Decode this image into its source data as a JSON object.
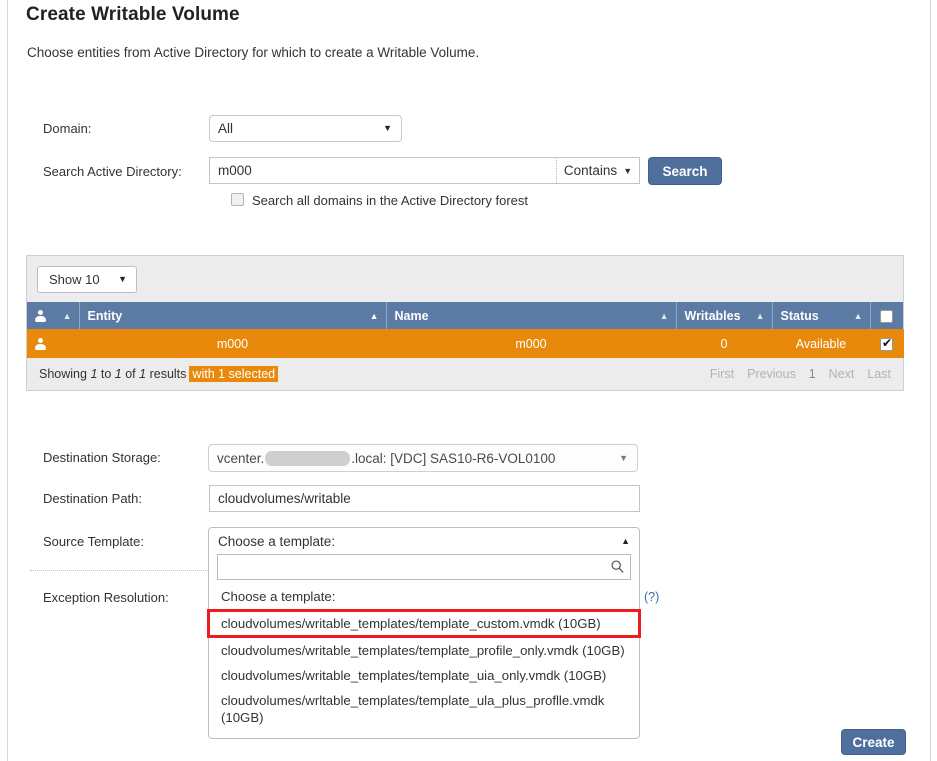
{
  "page": {
    "title": "Create Writable Volume",
    "subtitle": "Choose entities from Active Directory for which to create a Writable Volume."
  },
  "form": {
    "domain_label": "Domain:",
    "domain_value": "All",
    "search_label": "Search Active Directory:",
    "search_value": "m000",
    "search_placeholder": "",
    "search_scope_value": "Contains",
    "search_button_label": "Search",
    "search_all_domains_label": "Search all domains in the Active Directory forest",
    "search_all_domains_checked": false
  },
  "table": {
    "show_count_label": "Show 10",
    "columns": [
      {
        "label": "",
        "icon": "person-icon",
        "sort": "asc"
      },
      {
        "label": "Entity",
        "sort": "asc-active"
      },
      {
        "label": "Name",
        "sort": "asc"
      },
      {
        "label": "Writables",
        "sort": "asc"
      },
      {
        "label": "Status",
        "sort": "asc"
      },
      {
        "label": "",
        "icon": "select-all-checkbox",
        "sort": "none"
      }
    ],
    "rows": [
      {
        "entity": "m000",
        "name": "m000",
        "writables": "0",
        "status": "Available",
        "selected": true
      }
    ],
    "footer": {
      "showing_prefix": "Showing",
      "showing_from": "1",
      "showing_to_word": "to",
      "showing_to": "1",
      "showing_of_word": "of",
      "showing_total": "1",
      "showing_suffix": "results",
      "selected_badge": "with 1 selected",
      "pagination": [
        "First",
        "Previous",
        "1",
        "Next",
        "Last"
      ]
    }
  },
  "destination": {
    "storage_label": "Destination Storage:",
    "storage_value_prefix": "vcenter.",
    "storage_value_suffix": ".local: [VDC] SAS10-R6-VOL0100",
    "path_label": "Destination Path:",
    "path_value": "cloudvolumes/writable",
    "source_template_label": "Source Template:",
    "source_template_selected": "Choose a template:",
    "template_search_value": "",
    "template_options": [
      "Choose a template:",
      "cloudvolumes/writable_templates/template_custom.vmdk (10GB)",
      "cloudvolumes/writable_templates/template_profile_only.vmdk (10GB)",
      "cloudvolumes/writable_templates/template_uia_only.vmdk (10GB)",
      "cloudvolumes/wrltable_templates/template_ula_plus_proflle.vmdk (10GB)"
    ],
    "highlighted_option_index": 1,
    "exception_label": "Exception Resolution:",
    "exception_help": "(?)"
  },
  "actions": {
    "create_label": "Create"
  },
  "colors": {
    "accent_blue": "#4f6f9c",
    "header_blue": "#5b7ba5",
    "row_orange": "#e8890c",
    "highlight_red": "#ee1c1c",
    "link_blue": "#3b6ea8"
  }
}
